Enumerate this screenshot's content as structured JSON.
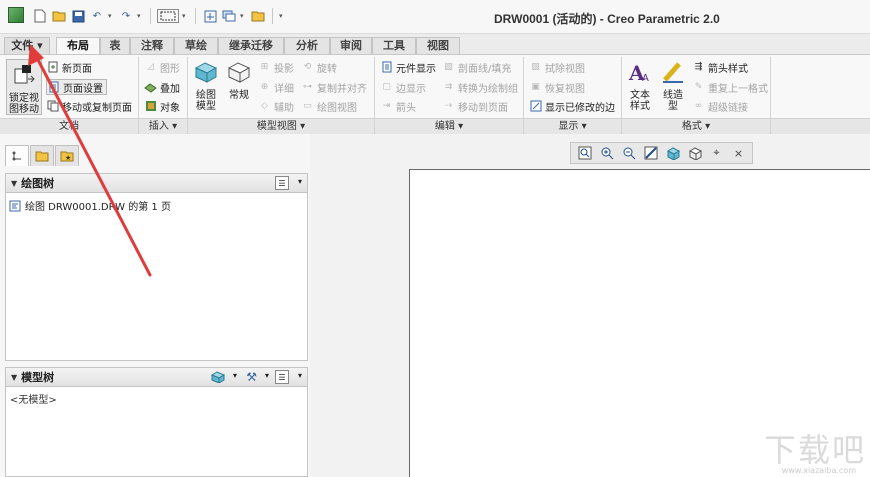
{
  "window": {
    "title": "DRW0001 (活动的) - Creo Parametric 2.0"
  },
  "tabs": {
    "file": "文件",
    "items": [
      "布局",
      "表",
      "注释",
      "草绘",
      "继承迁移",
      "分析",
      "审阅",
      "工具",
      "视图"
    ]
  },
  "ribbon": {
    "document": {
      "footer": "文档",
      "lock_label_1": "锁定视",
      "lock_label_2": "图移动",
      "new_page": "新页面",
      "page_setup": "页面设置",
      "move_copy_page": "移动或复制页面"
    },
    "insert": {
      "footer": "插入",
      "shape": "图形",
      "overlay": "叠加",
      "object": "对象"
    },
    "model_views": {
      "footer": "模型视图",
      "drawing_model_1": "绘图",
      "drawing_model_2": "模型",
      "general": "常规",
      "projection": "投影",
      "detail": "详细",
      "auxiliary": "辅助",
      "revolve": "旋转",
      "copy_align": "复制并对齐",
      "drawing_view": "绘图视图"
    },
    "edit": {
      "footer": "编辑",
      "element_display": "元件显示",
      "edge_display": "边显示",
      "arrow": "箭头",
      "section_fill": "剖面线/填充",
      "convert_group": "转换为绘制组",
      "move_to_page": "移动到页面"
    },
    "display": {
      "footer": "显示",
      "erase_view": "拭除视图",
      "resume_view": "恢复视图",
      "show_modified_edges": "显示已修改的边"
    },
    "format": {
      "footer": "格式",
      "text_style_1": "文本",
      "text_style_2": "样式",
      "line_style_1": "线造",
      "line_style_2": "型",
      "arrow_style": "箭头样式",
      "repeat_format": "重复上一格式",
      "hyperlink": "超级链接"
    }
  },
  "left_panel": {
    "drawing_tree": {
      "title": "绘图树",
      "item": "绘图 DRW0001.DRW 的第 1 页"
    },
    "model_tree": {
      "title": "模型树",
      "empty": "<无模型>"
    }
  },
  "watermark": {
    "main": "下载吧",
    "sub": "www.xiazaiba.com"
  },
  "colors": {
    "annotation_arrow": "#e03c3c",
    "accent": "#1f4f8c"
  }
}
